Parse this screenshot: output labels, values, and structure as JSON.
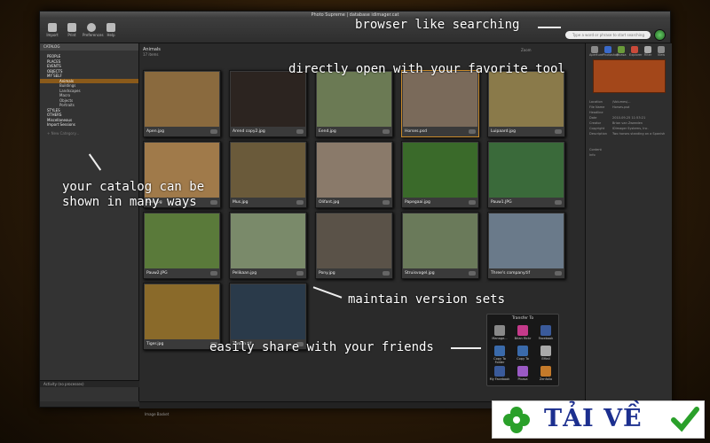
{
  "window": {
    "title": "Photo Supreme | database idimager.cat"
  },
  "toolbar": {
    "buttons": [
      {
        "label": "Import"
      },
      {
        "label": "Print"
      },
      {
        "label": "Preferences"
      },
      {
        "label": "Help"
      }
    ],
    "search_placeholder": "Type a word or phrase to start searching"
  },
  "sidebar": {
    "header": "CATALOG",
    "items": [
      {
        "label": "PEOPLE",
        "sub": false,
        "selected": false
      },
      {
        "label": "PLACES",
        "sub": false,
        "selected": false
      },
      {
        "label": "EVENTS",
        "sub": false,
        "selected": false
      },
      {
        "label": "OBJECTS",
        "sub": false,
        "selected": false
      },
      {
        "label": "MY SELF",
        "sub": false,
        "selected": false
      },
      {
        "label": "Animals",
        "sub": true,
        "selected": true
      },
      {
        "label": "Buildings",
        "sub": true,
        "selected": false
      },
      {
        "label": "Landscapes",
        "sub": true,
        "selected": false
      },
      {
        "label": "Macro",
        "sub": true,
        "selected": false
      },
      {
        "label": "Objects",
        "sub": true,
        "selected": false
      },
      {
        "label": "Portraits",
        "sub": true,
        "selected": false
      },
      {
        "label": "STYLES",
        "sub": false,
        "selected": false
      },
      {
        "label": "OTHERS",
        "sub": false,
        "selected": false
      },
      {
        "label": "Miscellaneous",
        "sub": false,
        "selected": false
      },
      {
        "label": "Import Sessions",
        "sub": false,
        "selected": false
      }
    ],
    "new_category": "+ New Category...",
    "activity": "Activity (no processes)"
  },
  "main": {
    "title": "Animals",
    "count": "17 items",
    "zoom": "Zoom",
    "basket": "Image Basket",
    "thumbs": [
      {
        "name": "Apen.jpg",
        "color": "#8a6a3e"
      },
      {
        "name": "Arend copy2.jpg",
        "color": "#2c2420"
      },
      {
        "name": "Eend.jpg",
        "color": "#6b7a54"
      },
      {
        "name": "Horses.psd",
        "color": "#7a6a5a"
      },
      {
        "name": "Luipaard.jpg",
        "color": "#8a7a4a"
      },
      {
        "name": "Ezel.jpg",
        "color": "#a07a4a"
      },
      {
        "name": "Mus.jpg",
        "color": "#6a5a3a"
      },
      {
        "name": "Olifant.jpg",
        "color": "#8a7a6a"
      },
      {
        "name": "Papegaai.jpg",
        "color": "#3a6a2a"
      },
      {
        "name": "Pauw1.JPG",
        "color": "#3a6a3a"
      },
      {
        "name": "Pauw2.JPG",
        "color": "#5a7a3a"
      },
      {
        "name": "Pelikaan.jpg",
        "color": "#7a8a6a"
      },
      {
        "name": "Pony.jpg",
        "color": "#5a5248"
      },
      {
        "name": "Struisvogel.jpg",
        "color": "#6a7a5a"
      },
      {
        "name": "Three's company.tif",
        "color": "#6a7a8a"
      },
      {
        "name": "Tiger.jpg",
        "color": "#8a6a2a"
      },
      {
        "name": "Zwaan.tif",
        "color": "#2a3a4a"
      }
    ]
  },
  "right_panel": {
    "icons": [
      "Aperture",
      "Photoshop",
      "Picasa",
      "Explorer",
      "Filter",
      "View"
    ],
    "meta": [
      {
        "key": "Location",
        "value": "/Volumes/..."
      },
      {
        "key": "File Name",
        "value": "Horses.psd"
      },
      {
        "key": "Headline",
        "value": ""
      },
      {
        "key": "Date",
        "value": "2010-09-25 11:53:21"
      },
      {
        "key": "Creator",
        "value": "Brian van Zweeden"
      },
      {
        "key": "Copyright",
        "value": "IDimager Systems, Inc."
      },
      {
        "key": "Description",
        "value": "Two horses standing on a Spanish"
      },
      {
        "key": "Content",
        "value": ""
      },
      {
        "key": "Info",
        "value": ""
      }
    ]
  },
  "transfer": {
    "title": "Transfer To",
    "items": [
      {
        "label": "Manage...",
        "color": "#888"
      },
      {
        "label": "Brian flickr",
        "color": "#c43a8a"
      },
      {
        "label": "Facebook",
        "color": "#3a5a9a"
      },
      {
        "label": "Copy To Folder",
        "color": "#3a6aaa"
      },
      {
        "label": "Copy To",
        "color": "#3a6aaa"
      },
      {
        "label": "EMail",
        "color": "#aaa"
      },
      {
        "label": "My Facebook",
        "color": "#3a5a9a"
      },
      {
        "label": "Picasa",
        "color": "#9a5ac4"
      },
      {
        "label": "Zenfolio",
        "color": "#c47a2a"
      }
    ]
  },
  "annotations": {
    "search": "browser like searching",
    "open": "directly open with your favorite tool",
    "catalog_1": "your catalog can be",
    "catalog_2": "shown in many ways",
    "versions": "maintain version sets",
    "share": "easily share with your friends"
  },
  "watermark": {
    "text": "TẢI VỀ"
  }
}
